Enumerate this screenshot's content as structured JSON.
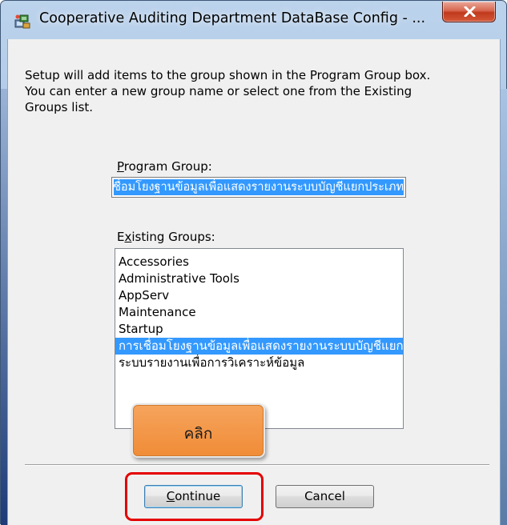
{
  "window": {
    "title": "Cooperative Auditing Department DataBase Config - ...",
    "icon": "setup-program-icon",
    "close_icon": "close-x-icon"
  },
  "description": {
    "line1": "Setup will add items to the group shown in the Program Group box.",
    "line2": "You can enter a new group name or select one from the Existing",
    "line3": "Groups list."
  },
  "program_group": {
    "label_accel": "P",
    "label_rest": "rogram Group:",
    "value": "การเชื่อมโยงฐานข้อมูลเพื่อแสดงรายงานระบบบัญชีแยกประเภท"
  },
  "existing_groups": {
    "label_pre": "E",
    "label_accel": "x",
    "label_rest": "isting Groups:",
    "items": [
      "Accessories",
      "Administrative Tools",
      "AppServ",
      "Maintenance",
      "Startup",
      "การเชื่อมโยงฐานข้อมูลเพื่อแสดงรายงานระบบบัญชีแยกประเภท",
      "ระบบรายงานเพื่อการวิเคราะห์ข้อมูล"
    ],
    "selected_index": 5
  },
  "buttons": {
    "continue_accel": "C",
    "continue_rest": "ontinue",
    "cancel": "Cancel"
  },
  "annotation": {
    "callout_text": "คลิก",
    "highlight_color": "#e50000",
    "callout_color": "#f08c37"
  },
  "colors": {
    "selection": "#3399ff",
    "dialog_bg": "#f0f0f0",
    "close_button": "#c0391c"
  }
}
